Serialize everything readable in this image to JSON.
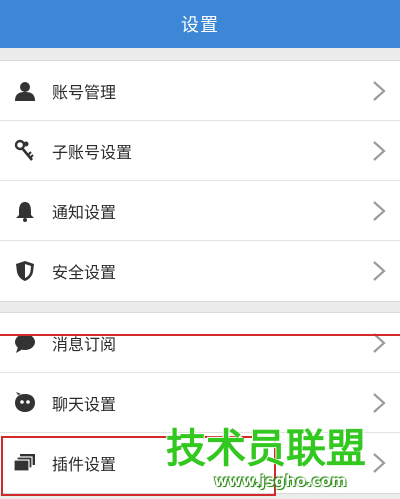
{
  "header": {
    "title": "设置"
  },
  "groups": [
    {
      "items": [
        {
          "label": "账号管理",
          "icon": "person-icon"
        },
        {
          "label": "子账号设置",
          "icon": "keys-icon"
        },
        {
          "label": "通知设置",
          "icon": "bell-icon"
        },
        {
          "label": "安全设置",
          "icon": "shield-icon"
        }
      ]
    },
    {
      "items": [
        {
          "label": "消息订阅",
          "icon": "chat-bubble-icon"
        },
        {
          "label": "聊天设置",
          "icon": "chat-face-icon"
        },
        {
          "label": "插件设置",
          "icon": "plugin-stack-icon"
        }
      ]
    }
  ],
  "watermark": {
    "title": "技术员联盟",
    "url": "www.jsgho.com"
  },
  "colors": {
    "header": "#3c87d6",
    "annotation": "#d12a2a",
    "watermark": "#33c81f"
  }
}
